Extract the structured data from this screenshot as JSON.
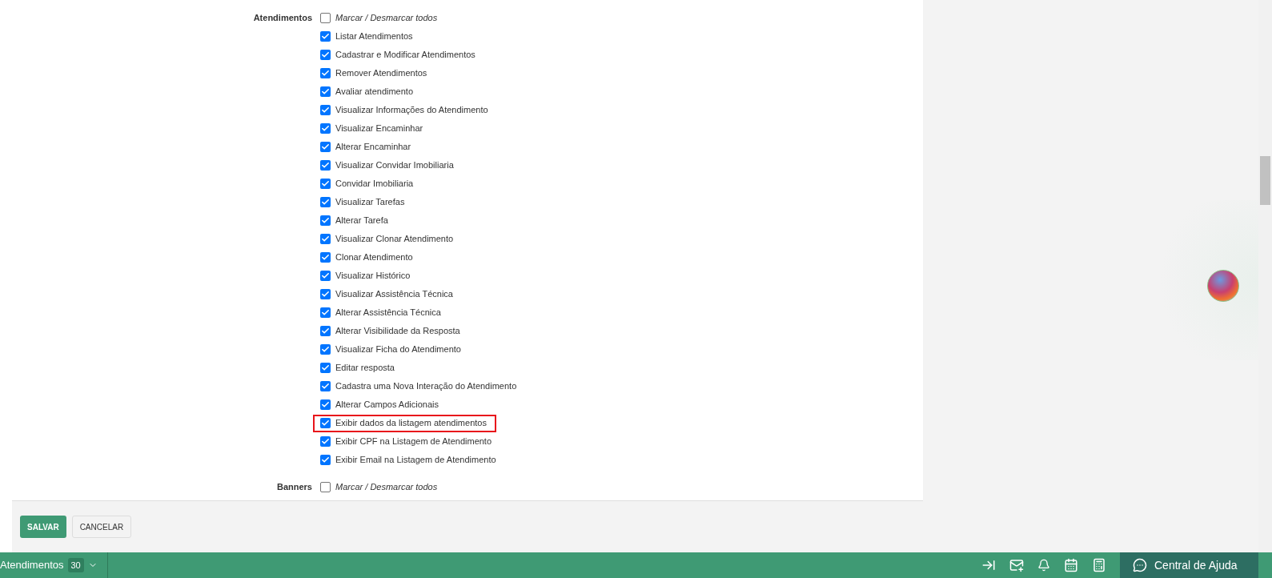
{
  "sections": [
    {
      "label": "Atendimentos",
      "toggle_all": {
        "label": "Marcar / Desmarcar todos",
        "checked": false
      },
      "items": [
        {
          "label": "Listar Atendimentos",
          "checked": true,
          "highlighted": false
        },
        {
          "label": "Cadastrar e Modificar Atendimentos",
          "checked": true,
          "highlighted": false
        },
        {
          "label": "Remover Atendimentos",
          "checked": true,
          "highlighted": false
        },
        {
          "label": "Avaliar atendimento",
          "checked": true,
          "highlighted": false
        },
        {
          "label": "Visualizar Informações do Atendimento",
          "checked": true,
          "highlighted": false
        },
        {
          "label": "Visualizar Encaminhar",
          "checked": true,
          "highlighted": false
        },
        {
          "label": "Alterar Encaminhar",
          "checked": true,
          "highlighted": false
        },
        {
          "label": "Visualizar Convidar Imobiliaria",
          "checked": true,
          "highlighted": false
        },
        {
          "label": "Convidar Imobiliaria",
          "checked": true,
          "highlighted": false
        },
        {
          "label": "Visualizar Tarefas",
          "checked": true,
          "highlighted": false
        },
        {
          "label": "Alterar Tarefa",
          "checked": true,
          "highlighted": false
        },
        {
          "label": "Visualizar Clonar Atendimento",
          "checked": true,
          "highlighted": false
        },
        {
          "label": "Clonar Atendimento",
          "checked": true,
          "highlighted": false
        },
        {
          "label": "Visualizar Histórico",
          "checked": true,
          "highlighted": false
        },
        {
          "label": "Visualizar Assistência Técnica",
          "checked": true,
          "highlighted": false
        },
        {
          "label": "Alterar Assistência Técnica",
          "checked": true,
          "highlighted": false
        },
        {
          "label": "Alterar Visibilidade da Resposta",
          "checked": true,
          "highlighted": false
        },
        {
          "label": "Visualizar Ficha do Atendimento",
          "checked": true,
          "highlighted": false
        },
        {
          "label": "Editar resposta",
          "checked": true,
          "highlighted": false
        },
        {
          "label": "Cadastra uma Nova Interação do Atendimento",
          "checked": true,
          "highlighted": false
        },
        {
          "label": "Alterar Campos Adicionais",
          "checked": true,
          "highlighted": false
        },
        {
          "label": "Exibir dados da listagem atendimentos",
          "checked": true,
          "highlighted": true
        },
        {
          "label": "Exibir CPF na Listagem de Atendimento",
          "checked": true,
          "highlighted": false
        },
        {
          "label": "Exibir Email na Listagem de Atendimento",
          "checked": true,
          "highlighted": false
        }
      ]
    },
    {
      "label": "Banners",
      "toggle_all": {
        "label": "Marcar / Desmarcar todos",
        "checked": false
      }
    }
  ],
  "buttons": [
    {
      "label": "SALVAR",
      "kind": "primary"
    },
    {
      "label": "CANCELAR",
      "kind": "secondary"
    }
  ],
  "bottom_bar": {
    "module": "Atendimentos",
    "count": "30",
    "help": "Central de Ajuda"
  }
}
